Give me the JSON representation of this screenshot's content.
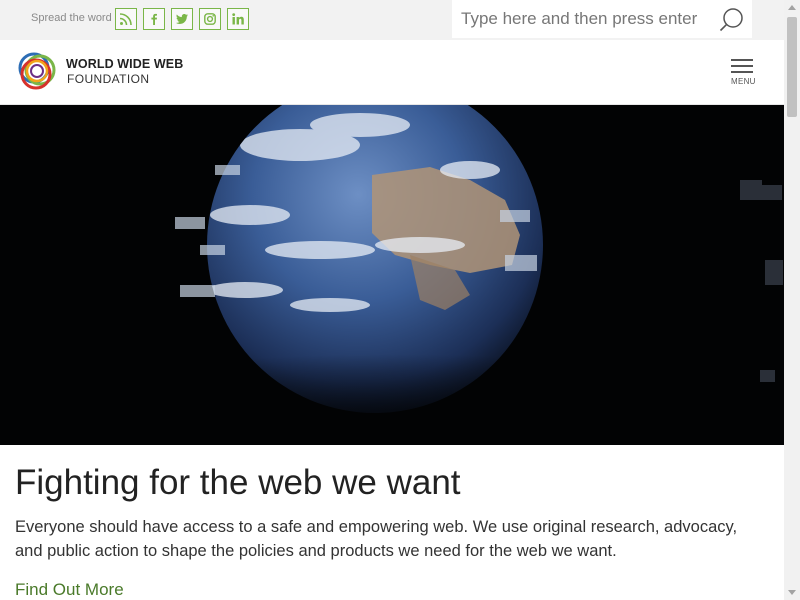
{
  "topbar": {
    "spread_label": "Spread the word",
    "social": [
      {
        "icon": "rss-icon"
      },
      {
        "icon": "facebook-icon"
      },
      {
        "icon": "twitter-icon"
      },
      {
        "icon": "instagram-icon"
      },
      {
        "icon": "linkedin-icon"
      }
    ],
    "search_placeholder": "Type here and then press enter"
  },
  "header": {
    "brand_line1": "WORLD WIDE WEB",
    "brand_line2": "FOUNDATION",
    "menu_label": "MENU"
  },
  "main": {
    "headline": "Fighting for the web we want",
    "intro": "Everyone should have access to a safe and empowering web. We use original research, advocacy, and public action to shape the policies and products we need for the web we want.",
    "cta": "Find Out More"
  },
  "colors": {
    "accent_green": "#7ab648",
    "link_green": "#4a7a2a",
    "hero_background": "#020304"
  }
}
